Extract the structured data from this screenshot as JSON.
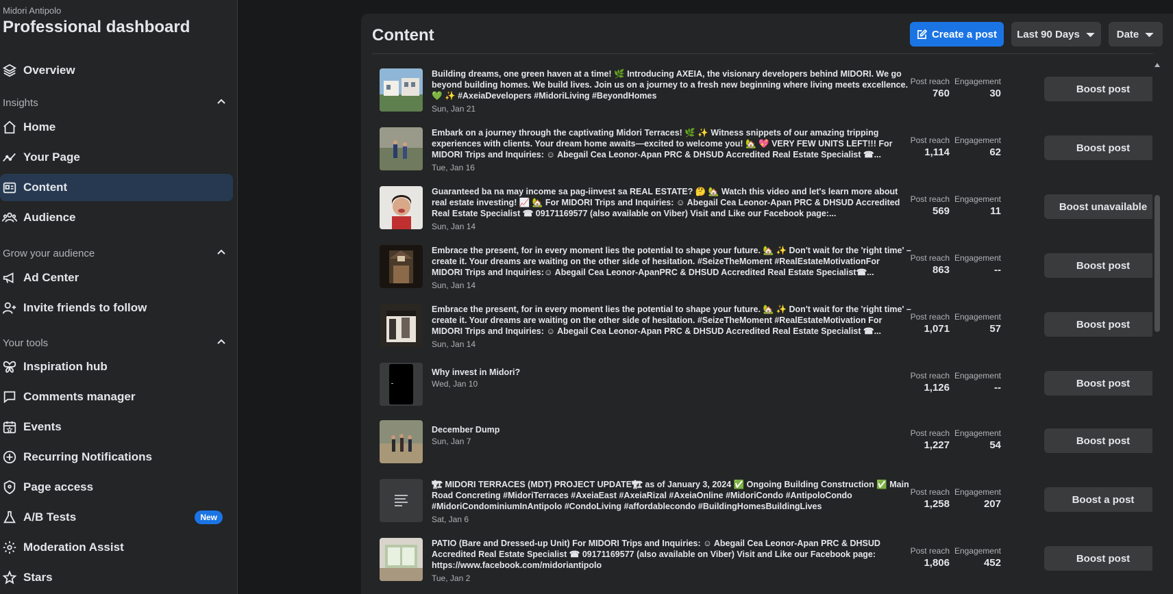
{
  "sidebar": {
    "page_name": "Midori Antipolo",
    "title": "Professional dashboard",
    "overview": {
      "label": "Overview",
      "icon": "layers-icon"
    },
    "insights": {
      "title": "Insights",
      "items": [
        {
          "label": "Home",
          "icon": "home-icon"
        },
        {
          "label": "Your Page",
          "icon": "trend-icon"
        },
        {
          "label": "Content",
          "icon": "content-icon"
        },
        {
          "label": "Audience",
          "icon": "people-icon"
        }
      ]
    },
    "grow": {
      "title": "Grow your audience",
      "items": [
        {
          "label": "Ad Center",
          "icon": "megaphone-icon"
        },
        {
          "label": "Invite friends to follow",
          "icon": "add-friend-icon"
        }
      ]
    },
    "tools": {
      "title": "Your tools",
      "items": [
        {
          "label": "Inspiration hub",
          "icon": "butterfly-icon"
        },
        {
          "label": "Comments manager",
          "icon": "comment-icon"
        },
        {
          "label": "Events",
          "icon": "calendar-icon"
        },
        {
          "label": "Recurring Notifications",
          "icon": "plus-circle-icon"
        },
        {
          "label": "Page access",
          "icon": "shield-icon"
        },
        {
          "label": "A/B Tests",
          "icon": "flask-icon",
          "badge": "New"
        },
        {
          "label": "Moderation Assist",
          "icon": "gear-icon"
        },
        {
          "label": "Stars",
          "icon": "star-icon"
        }
      ]
    },
    "active_item": "Content"
  },
  "content": {
    "title": "Content",
    "create_post_label": "Create a post",
    "date_range_label": "Last 90 Days",
    "sort_label": "Date",
    "reach_label": "Post reach",
    "engagement_label": "Engagement",
    "posts": [
      {
        "text": "Building dreams, one green haven at a time! 🌿 Introducing AXEIA, the visionary developers behind MIDORI. We go beyond building homes. We build lives. Join us on a journey to a fresh new beginning where living meets excellence. 💚 ✨ #AxeiaDevelopers #MidoriLiving #BeyondHomes",
        "date": "Sun, Jan 21",
        "reach": "760",
        "engagement": "30",
        "button": "Boost post"
      },
      {
        "text": "Embark on a journey through the captivating Midori Terraces! 🌿 ✨ Witness snippets of our amazing tripping experiences with clients. Your dream home awaits—excited to welcome you! 🏡 💖 VERY FEW UNITS LEFT!!! For MIDORI Trips and Inquiries: ☺ Abegail Cea Leonor-Apan PRC & DHSUD Accredited Real Estate Specialist ☎...",
        "date": "Tue, Jan 16",
        "reach": "1,114",
        "engagement": "62",
        "button": "Boost post"
      },
      {
        "text": "Guaranteed ba na may income sa pag-iinvest sa REAL ESTATE? 🤔 🏡 Watch this video and let's learn more about real estate investing! 📈 🏡 For MIDORI Trips and Inquiries: ☺ Abegail Cea Leonor-Apan PRC & DHSUD Accredited Real Estate Specialist ☎ 09171169577 (also available on Viber) Visit and Like our Facebook page:...",
        "date": "Sun, Jan 14",
        "reach": "569",
        "engagement": "11",
        "button": "Boost unavailable"
      },
      {
        "text": "Embrace the present, for in every moment lies the potential to shape your future. 🏡 ✨ Don't wait for the 'right time' – create it. Your dreams are waiting on the other side of hesitation. #SeizeTheMoment #RealEstateMotivationFor MIDORI Trips and Inquiries:☺ Abegail Cea Leonor-ApanPRC & DHSUD Accredited Real Estate Specialist☎...",
        "date": "Sun, Jan 14",
        "reach": "863",
        "engagement": "--",
        "button": "Boost post"
      },
      {
        "text": "Embrace the present, for in every moment lies the potential to shape your future. 🏡 ✨ Don't wait for the 'right time' – create it. Your dreams are waiting on the other side of hesitation. #SeizeTheMoment #RealEstateMotivation For MIDORI Trips and Inquiries: ☺ Abegail Cea Leonor-Apan PRC & DHSUD Accredited Real Estate Specialist ☎...",
        "date": "Sun, Jan 14",
        "reach": "1,071",
        "engagement": "57",
        "button": "Boost post"
      },
      {
        "text": "Why invest in Midori?",
        "date": "Wed, Jan 10",
        "reach": "1,126",
        "engagement": "--",
        "button": "Boost post"
      },
      {
        "text": "December Dump",
        "date": "Sun, Jan 7",
        "reach": "1,227",
        "engagement": "54",
        "button": "Boost post"
      },
      {
        "text": "🏗 MIDORI TERRACES (MDT) PROJECT UPDATE🏗 as of January 3, 2024 ✅ Ongoing Building Construction ✅ Main Road Concreting #MidoriTerraces #AxeiaEast #AxeiaRizal #AxeiaOnline #MidoriCondo #AntipoloCondo #MidoriCondominiumInAntipolo #CondoLiving #affordablecondo #BuildingHomesBuildingLives",
        "date": "Sat, Jan 6",
        "reach": "1,258",
        "engagement": "207",
        "button": "Boost a post"
      },
      {
        "text": "PATIO (Bare and Dressed-up Unit) For MIDORI Trips and Inquiries: ☺ Abegail Cea Leonor-Apan PRC & DHSUD Accredited Real Estate Specialist ☎ 09171169577 (also available on Viber) Visit and Like our Facebook page: https://www.facebook.com/midoriantipolo",
        "date": "Tue, Jan 2",
        "reach": "1,806",
        "engagement": "452",
        "button": "Boost post"
      }
    ]
  },
  "colors": {
    "accent": "#1b74e4",
    "active_bg": "#263951",
    "panel_bg": "#242526",
    "page_bg": "#18191a"
  }
}
